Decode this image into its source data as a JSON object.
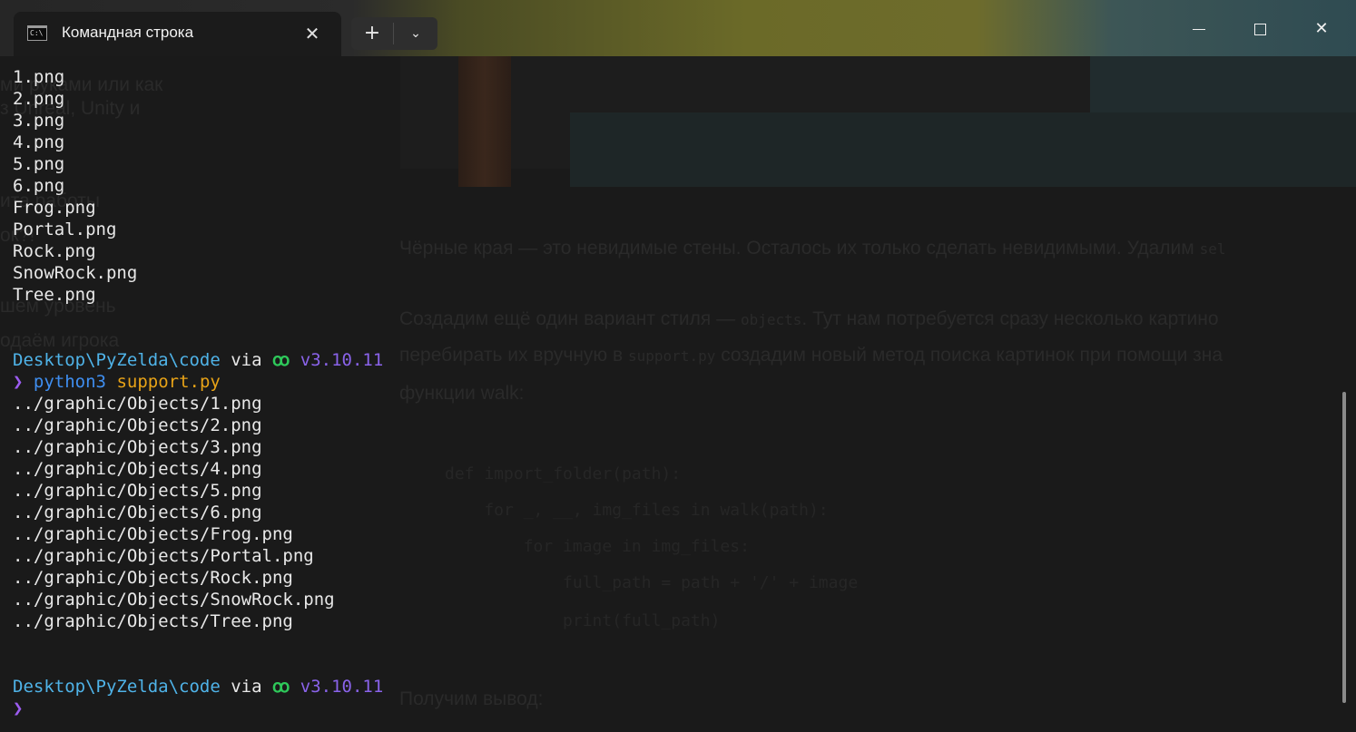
{
  "window": {
    "tab_title": "Командная строка",
    "tab_icon": "cmd-icon",
    "tab_icon_glyph": "C:\\",
    "close_tab_glyph": "✕",
    "new_tab_glyph": "+",
    "dropdown_glyph": "⌄",
    "close_glyph": "✕"
  },
  "terminal": {
    "files": [
      "1.png",
      "2.png",
      "3.png",
      "4.png",
      "5.png",
      "6.png",
      "Frog.png",
      "Portal.png",
      "Rock.png",
      "SnowRock.png",
      "Tree.png"
    ],
    "prompt1": {
      "path": "Desktop\\PyZelda\\code",
      "via": " via ",
      "icon": "python-icon",
      "version": "v3.10.11"
    },
    "command": {
      "arrow": "❯",
      "program": "python3",
      "argument": "support.py"
    },
    "output": [
      "../graphic/Objects/1.png",
      "../graphic/Objects/2.png",
      "../graphic/Objects/3.png",
      "../graphic/Objects/4.png",
      "../graphic/Objects/5.png",
      "../graphic/Objects/6.png",
      "../graphic/Objects/Frog.png",
      "../graphic/Objects/Portal.png",
      "../graphic/Objects/Rock.png",
      "../graphic/Objects/SnowRock.png",
      "../graphic/Objects/Tree.png"
    ],
    "prompt2": {
      "path": "Desktop\\PyZelda\\code",
      "via": " via ",
      "icon": "python-icon",
      "version": "v3.10.11",
      "arrow": "❯"
    }
  },
  "background_article": {
    "left_lines": [
      "ми руками или как",
      "з Unreal, Unity и",
      "",
      "",
      "ита работы",
      "ок?!",
      "",
      "шем уровень",
      "",
      "одаём игрока"
    ],
    "para1": "Чёрные края — это невидимые стены. Осталось их только сделать невидимыми. Удалим",
    "para1_code": "sel",
    "para2_a": "Создадим ещё один вариант стиля —",
    "para2_code": "objects",
    "para2_b": ". Тут нам потребуется сразу несколько картино",
    "para3_a": "перебирать их вручную в",
    "para3_code": "support.py",
    "para3_b": "создадим новый метод поиска картинок при помощи зна",
    "para4": "функции walk:",
    "code_lines": [
      "def import_folder(path):",
      "    for _, __, img_files in walk(path):",
      "        for image in img_files:",
      "            full_path = path + '/' + image",
      "            print(full_path)"
    ],
    "para5": "Получим вывод:"
  },
  "colors": {
    "path": "#4fb3e8",
    "version": "#8a63ea",
    "arrow": "#9c5cf0",
    "command": "#3f8ef0",
    "argument": "#e8a317",
    "python_icon": "#2ec95a"
  }
}
